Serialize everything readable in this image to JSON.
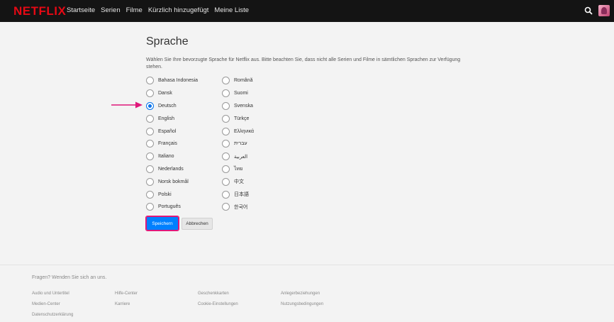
{
  "header": {
    "logo": "NETFLIX",
    "nav": [
      "Startseite",
      "Serien",
      "Filme",
      "Kürzlich hinzugefügt",
      "Meine Liste"
    ]
  },
  "page": {
    "title": "Sprache",
    "description": "Wählen Sie Ihre bevorzugte Sprache für Netflix aus. Bitte beachten Sie, dass nicht alle Serien und Filme in sämtlichen Sprachen zur Verfügung stehen."
  },
  "languages": {
    "column1": [
      "Bahasa Indonesia",
      "Dansk",
      "Deutsch",
      "English",
      "Español",
      "Français",
      "Italiano",
      "Nederlands",
      "Norsk bokmål",
      "Polski",
      "Português"
    ],
    "column2": [
      "Română",
      "Suomi",
      "Svenska",
      "Türkçe",
      "Ελληνικά",
      "עברית",
      "العربية",
      "ไทย",
      "中文",
      "日本語",
      "한국어"
    ],
    "selected": "Deutsch"
  },
  "buttons": {
    "save": "Speichern",
    "cancel": "Abbrechen"
  },
  "footer": {
    "contact": "Fragen? Wenden Sie sich an uns.",
    "links": [
      [
        "Audio und Untertitel",
        "Hilfe-Center",
        "Geschenkkarten",
        "Anlegerbeziehungen"
      ],
      [
        "Medien-Center",
        "Karriere",
        "Cookie-Einstellungen",
        "Nutzungsbedingungen"
      ],
      [
        "Datenschutzerklärung"
      ]
    ]
  },
  "colors": {
    "brand": "#e50914",
    "topbar": "#141414",
    "accent": "#0080ff",
    "highlight": "#e0177a"
  }
}
